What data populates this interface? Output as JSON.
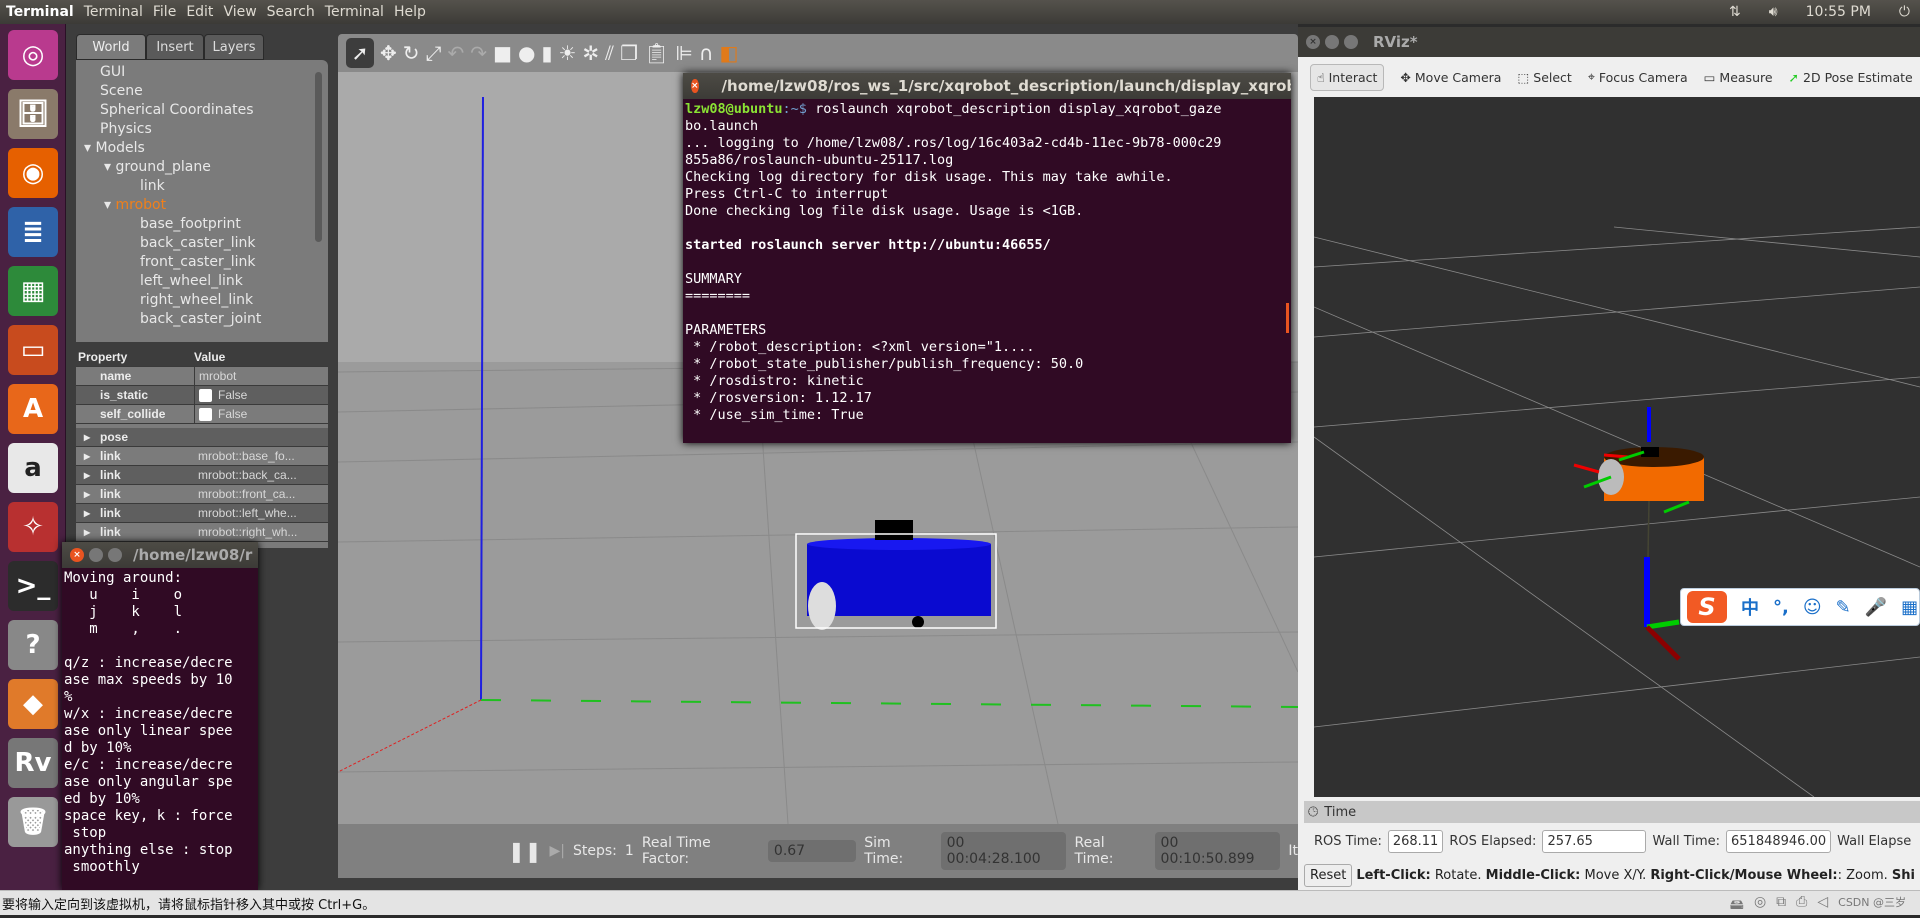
{
  "topbar": {
    "app_name": "Terminal",
    "menus": [
      "Terminal",
      "File",
      "Edit",
      "View",
      "Search",
      "Terminal",
      "Help"
    ],
    "clock": "10:55 PM",
    "icons": [
      "network-icon",
      "volume-icon",
      "power-icon"
    ]
  },
  "launcher": {
    "items": [
      {
        "icon": "ubuntu-dash-icon",
        "color": "#b93a8e"
      },
      {
        "icon": "files-icon",
        "color": "#8a7a6a"
      },
      {
        "icon": "firefox-icon",
        "color": "#e66000"
      },
      {
        "icon": "writer-icon",
        "color": "#2f62a8"
      },
      {
        "icon": "calc-icon",
        "color": "#2d8a3a"
      },
      {
        "icon": "impress-icon",
        "color": "#c84b1e"
      },
      {
        "icon": "software-center-icon",
        "color": "#e8671a"
      },
      {
        "icon": "amazon-icon",
        "color": "#e8e8e8"
      },
      {
        "icon": "settings-icon",
        "color": "#b83030"
      },
      {
        "icon": "terminal-icon",
        "color": "#2c2c2c"
      },
      {
        "icon": "help-icon",
        "color": "#888888"
      },
      {
        "icon": "gazebo-icon",
        "color": "#e07a2a"
      },
      {
        "icon": "rviz-icon",
        "color": "#777777"
      },
      {
        "icon": "trash-icon",
        "color": "#999999"
      }
    ]
  },
  "gazebo": {
    "tabs": [
      "World",
      "Insert",
      "Layers"
    ],
    "tree": [
      {
        "label": "GUI",
        "level": 0
      },
      {
        "label": "Scene",
        "level": 0
      },
      {
        "label": "Spherical Coordinates",
        "level": 0
      },
      {
        "label": "Physics",
        "level": 0
      },
      {
        "label": "Models",
        "level": 0,
        "expanded": true
      },
      {
        "label": "ground_plane",
        "level": 1,
        "expanded": true
      },
      {
        "label": "link",
        "level": 2
      },
      {
        "label": "mrobot",
        "level": 1,
        "expanded": true,
        "selected": true
      },
      {
        "label": "base_footprint",
        "level": 2
      },
      {
        "label": "back_caster_link",
        "level": 2
      },
      {
        "label": "front_caster_link",
        "level": 2
      },
      {
        "label": "left_wheel_link",
        "level": 2
      },
      {
        "label": "right_wheel_link",
        "level": 2
      },
      {
        "label": "back_caster_joint",
        "level": 2
      }
    ],
    "properties": {
      "header": [
        "Property",
        "Value"
      ],
      "rows": [
        {
          "key": "name",
          "value": "mrobot"
        },
        {
          "key": "is_static",
          "value": "False",
          "checkbox": true,
          "checked": false
        },
        {
          "key": "self_collide",
          "value": "False",
          "checkbox": true,
          "checked": false
        },
        {
          "key": "pose",
          "value": "",
          "expandable": true
        },
        {
          "key": "link",
          "value": "mrobot::base_fo...",
          "expandable": true
        },
        {
          "key": "link",
          "value": "mrobot::back_ca...",
          "expandable": true
        },
        {
          "key": "link",
          "value": "mrobot::front_ca...",
          "expandable": true
        },
        {
          "key": "link",
          "value": "mrobot::left_whe...",
          "expandable": true
        },
        {
          "key": "link",
          "value": "mrobot::right_wh...",
          "expandable": true
        }
      ]
    },
    "bottom": {
      "steps_label": "Steps:",
      "steps": "1",
      "rtf_label": "Real Time Factor:",
      "rtf": "0.67",
      "sim_label": "Sim Time:",
      "sim": "00 00:04:28.100",
      "real_label": "Real Time:",
      "real": "00 00:10:50.899",
      "iter_label": "It"
    },
    "accent": "#f07f1a"
  },
  "terminal_main": {
    "title": "/home/lzw08/ros_ws_1/src/xqrobot_description/launch/display_xqrobot",
    "prompt": "lzw08@ubuntu",
    "prompt_suffix": ":~$ ",
    "command": "roslaunch xqrobot_description display_xqrobot_gaze\nbo.launch",
    "output": "... logging to /home/lzw08/.ros/log/16c403a2-cd4b-11ec-9b78-000c29\n855a86/roslaunch-ubuntu-25117.log\nChecking log directory for disk usage. This may take awhile.\nPress Ctrl-C to interrupt\nDone checking log file disk usage. Usage is <1GB.\n",
    "server_line": "started roslaunch server http://ubuntu:46655/",
    "output2": "SUMMARY\n========\n\nPARAMETERS\n * /robot_description: <?xml version=\"1....\n * /robot_state_publisher/publish_frequency: 50.0\n * /rosdistro: kinetic\n * /rosversion: 1.12.17\n * /use_sim_time: True"
  },
  "terminal_teleop": {
    "title": "/home/lzw08/r",
    "output": "Moving around:\n   u    i    o\n   j    k    l\n   m    ,    .\n\nq/z : increase/decre\nase max speeds by 10\n%\nw/x : increase/decre\nase only linear spee\nd by 10%\ne/c : increase/decre\nase only angular spe\ned by 10%\nspace key, k : force\n stop\nanything else : stop\n smoothly"
  },
  "rviz": {
    "title": "RViz*",
    "tools": [
      {
        "label": "Interact",
        "icon": "hand-icon",
        "active": true
      },
      {
        "label": "Move Camera",
        "icon": "move-camera-icon"
      },
      {
        "label": "Select",
        "icon": "select-icon"
      },
      {
        "label": "Focus Camera",
        "icon": "focus-camera-icon"
      },
      {
        "label": "Measure",
        "icon": "ruler-icon"
      },
      {
        "label": "2D Pose Estimate",
        "icon": "pose-arrow-icon"
      }
    ],
    "time_panel": "Time",
    "ros_time_label": "ROS Time:",
    "ros_time": "268.11",
    "ros_elapsed_label": "ROS Elapsed:",
    "ros_elapsed": "257.65",
    "wall_time_label": "Wall Time:",
    "wall_time": "651848946.00",
    "wall_elapsed_label": "Wall Elapse",
    "reset": "Reset",
    "status": [
      {
        "b": "Left-Click:",
        "t": " Rotate. "
      },
      {
        "b": "Middle-Click:",
        "t": " Move X/Y. "
      },
      {
        "b": "Right-Click/Mouse Wheel:",
        "t": ": Zoom. "
      },
      {
        "b": "Shi",
        "t": ""
      }
    ]
  },
  "ime": {
    "items": [
      "中",
      "°,",
      "☺",
      "✎",
      "🎤",
      "▦"
    ]
  },
  "vmbar": {
    "message": "要将输入定向到该虚拟机，请将鼠标指针移入其中或按 Ctrl+G。",
    "watermark": "CSDN @三岁"
  }
}
